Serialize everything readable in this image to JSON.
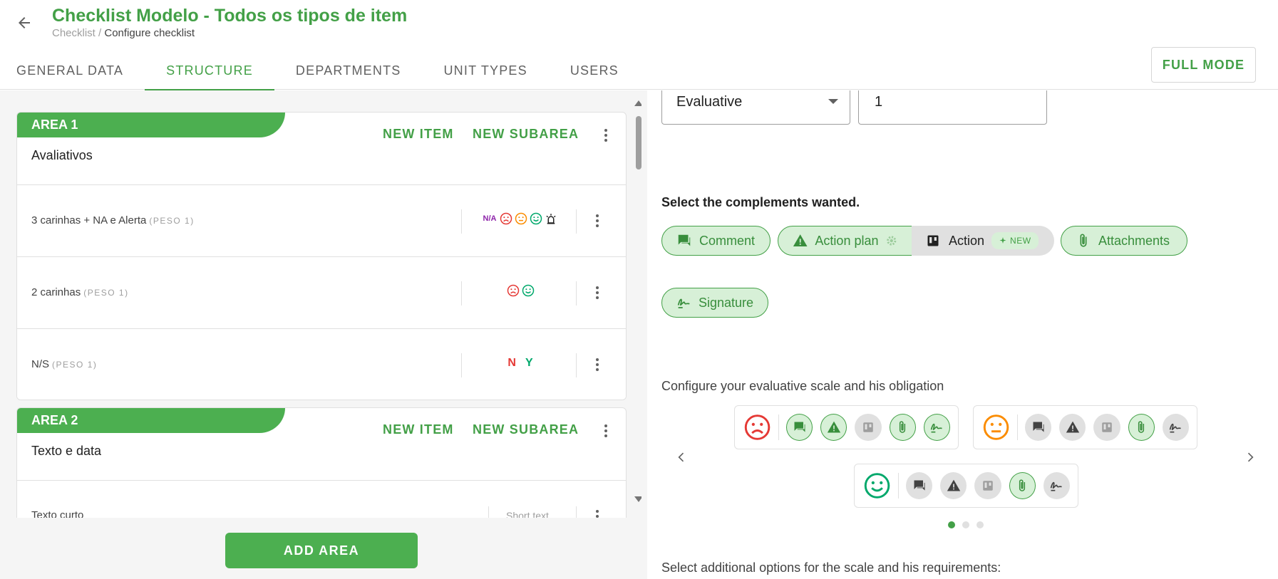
{
  "header": {
    "title": "Checklist Modelo - Todos os tipos de item",
    "breadcrumb_root": "Checklist",
    "breadcrumb_sep": " / ",
    "breadcrumb_current": "Configure checklist",
    "full_mode_label": "FULL MODE"
  },
  "tabs": [
    {
      "label": "GENERAL DATA",
      "active": false
    },
    {
      "label": "STRUCTURE",
      "active": true
    },
    {
      "label": "DEPARTMENTS",
      "active": false
    },
    {
      "label": "UNIT TYPES",
      "active": false
    },
    {
      "label": "USERS",
      "active": false
    }
  ],
  "areas": [
    {
      "tag": "AREA 1",
      "name": "Avaliativos",
      "new_item_label": "NEW ITEM",
      "new_subarea_label": "NEW SUBAREA",
      "items": [
        {
          "label": "3 carinhas + NA e Alerta",
          "weight": "(PESO 1)",
          "icons": [
            "na-text",
            "sad-face-icon",
            "neutral-face-icon",
            "happy-face-icon",
            "alarm-icon"
          ],
          "na_text": "N/A"
        },
        {
          "label": "2 carinhas",
          "weight": "(PESO 1)",
          "icons": [
            "sad-face-icon",
            "happy-face-icon"
          ]
        },
        {
          "label": "N/S",
          "weight": "(PESO 1)",
          "no_text": "N",
          "yes_text": "Y"
        }
      ]
    },
    {
      "tag": "AREA 2",
      "name": "Texto e data",
      "new_item_label": "NEW ITEM",
      "new_subarea_label": "NEW SUBAREA",
      "items": [
        {
          "label": "Texto curto",
          "type_label": "Short text"
        }
      ]
    }
  ],
  "add_area_label": "ADD AREA",
  "config": {
    "type_select_value": "Evaluative",
    "number_value": "1",
    "complements_title": "Select the complements wanted.",
    "chips": {
      "comment": "Comment",
      "action_plan": "Action plan",
      "action": "Action",
      "new_badge": "NEW",
      "attachments": "Attachments",
      "signature": "Signature"
    },
    "scale_title": "Configure your evaluative scale and his obligation",
    "additional_title": "Select additional options for the scale and his requirements:",
    "carousel_pages": 3,
    "carousel_active": 0
  },
  "colors": {
    "brand_green": "#43a047",
    "chip_bg": "#d7f0d7",
    "sad_red": "#e53935",
    "neutral_orange": "#fb8c00",
    "happy_green": "#00a86b",
    "na_purple": "#8e24aa"
  }
}
